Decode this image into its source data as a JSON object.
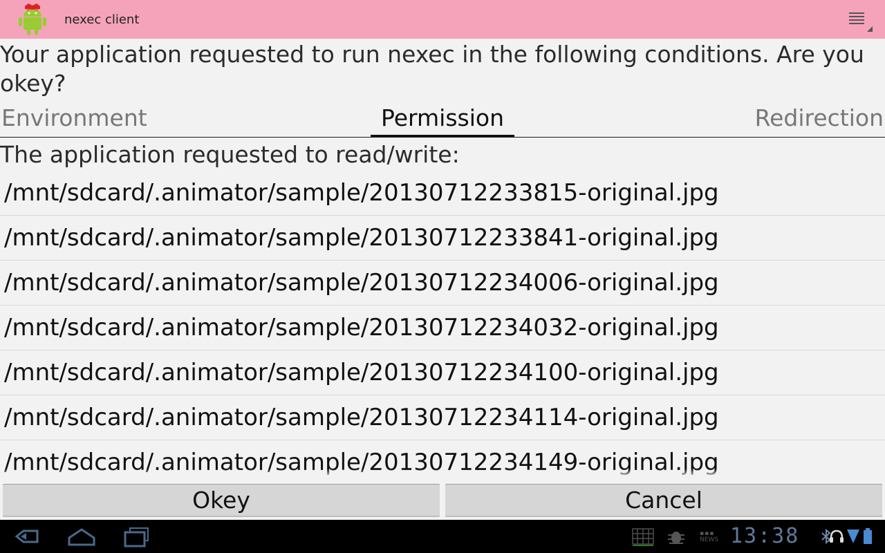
{
  "app": {
    "title": "nexec client",
    "accent": "#f5a3bb"
  },
  "icons": {
    "app": "android-robot-icon",
    "menu": "overflow-menu-icon",
    "back": "back-icon",
    "home": "home-icon",
    "recents": "recent-apps-icon",
    "keyboard": "keyboard-icon",
    "debug": "usb-debugging-icon",
    "news": "bbc-news-icon",
    "bluetooth": "bluetooth-icon",
    "headset": "headset-icon",
    "wifi": "wifi-icon",
    "battery": "battery-icon"
  },
  "prompt": "Your application requested to run nexec in the following conditions. Are you okey?",
  "tabs": [
    "Environment",
    "Permission",
    "Redirection"
  ],
  "selected_tab": "Permission",
  "subheading": "The application requested to read/write:",
  "files": [
    "/mnt/sdcard/.animator/sample/20130712233815-original.jpg",
    "/mnt/sdcard/.animator/sample/20130712233841-original.jpg",
    "/mnt/sdcard/.animator/sample/20130712234006-original.jpg",
    "/mnt/sdcard/.animator/sample/20130712234032-original.jpg",
    "/mnt/sdcard/.animator/sample/20130712234100-original.jpg",
    "/mnt/sdcard/.animator/sample/20130712234114-original.jpg",
    "/mnt/sdcard/.animator/sample/20130712234149-original.jpg"
  ],
  "buttons": {
    "ok": "Okey",
    "cancel": "Cancel"
  },
  "status": {
    "time": "13:38",
    "news_label": "NEWS"
  }
}
